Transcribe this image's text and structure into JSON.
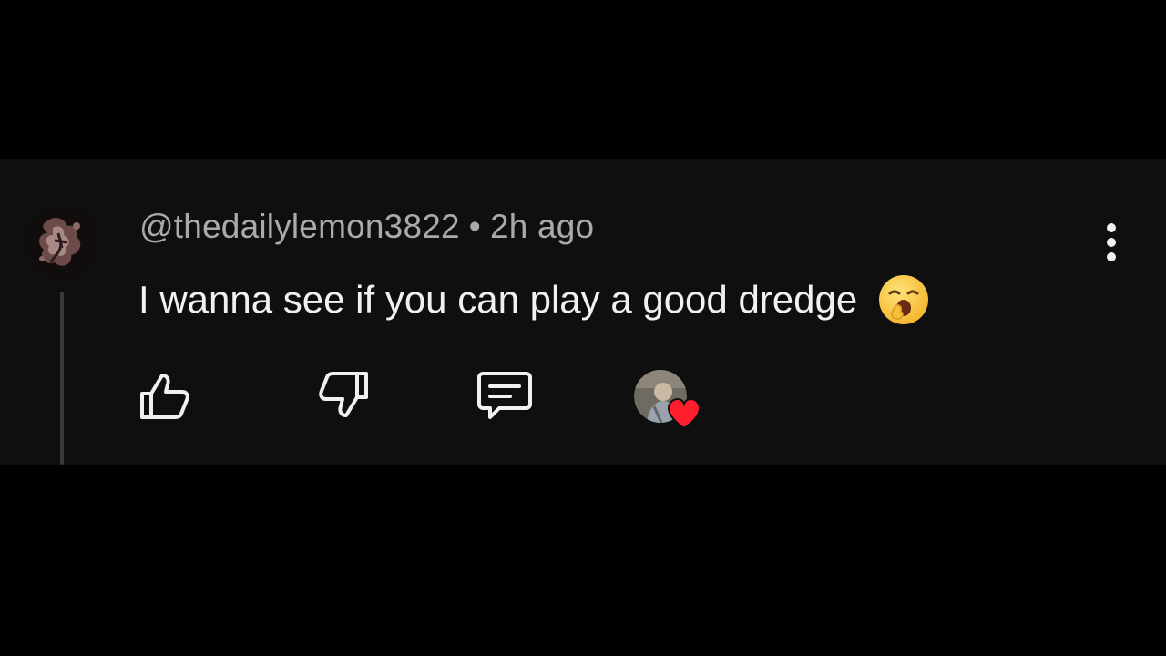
{
  "comment": {
    "author_handle": "@thedailylemon3822",
    "separator": "•",
    "timestamp": "2h ago",
    "text": "I wanna see if you can play a good dredge",
    "emoji": "yawning-face-emoji"
  },
  "actions": {
    "like_icon": "thumbs-up-icon",
    "dislike_icon": "thumbs-down-icon",
    "reply_icon": "reply-comment-icon",
    "more_icon": "more-vertical-icon",
    "creator_heart_icon": "creator-heart-icon"
  },
  "colors": {
    "background": "#000000",
    "card": "#0f0f0f",
    "meta_text": "#aaaaaa",
    "body_text": "#f1f1f1",
    "icon": "#f1f1f1",
    "heart": "#ff1e2d"
  }
}
